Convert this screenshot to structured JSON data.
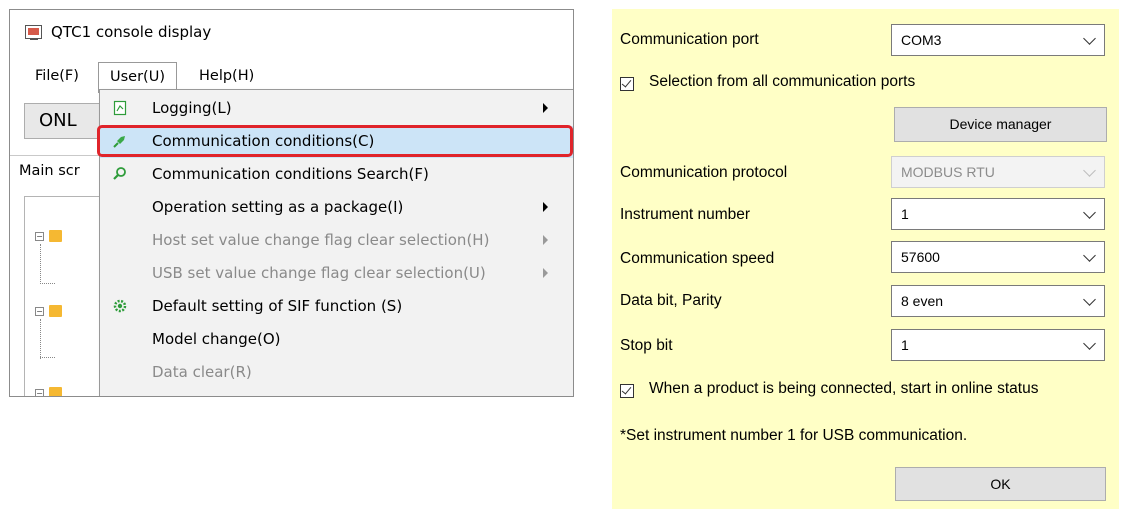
{
  "window": {
    "title": "QTC1 console display",
    "menu": {
      "file": "File(F)",
      "user": "User(U)",
      "help": "Help(H)"
    },
    "online_button": "ONL",
    "main_tab": "Main scr"
  },
  "user_menu": {
    "items": [
      {
        "label": "Logging(L)",
        "icon": "log-icon",
        "submenu": true,
        "disabled": false
      },
      {
        "label": "Communication conditions(C)",
        "icon": "plug-icon",
        "submenu": false,
        "disabled": false,
        "highlighted": true
      },
      {
        "label": "Communication conditions Search(F)",
        "icon": "search-icon",
        "submenu": false,
        "disabled": false
      },
      {
        "label": "Operation setting as a package(I)",
        "icon": "",
        "submenu": true,
        "disabled": false
      },
      {
        "label": "Host set value change flag clear selection(H)",
        "icon": "",
        "submenu": true,
        "disabled": true
      },
      {
        "label": "USB set value change flag clear selection(U)",
        "icon": "",
        "submenu": true,
        "disabled": true
      },
      {
        "label": "Default setting of SIF function (S)",
        "icon": "gear-icon",
        "submenu": false,
        "disabled": false
      },
      {
        "label": "Model change(O)",
        "icon": "",
        "submenu": false,
        "disabled": false
      },
      {
        "label": "Data clear(R)",
        "icon": "",
        "submenu": false,
        "disabled": true
      }
    ]
  },
  "dialog": {
    "port_label": "Communication port",
    "port_value": "COM3",
    "all_ports_label": "Selection from all communication ports",
    "all_ports_checked": true,
    "device_manager_button": "Device manager",
    "protocol_label": "Communication protocol",
    "protocol_value": "MODBUS RTU",
    "instrument_label": "Instrument number",
    "instrument_value": "1",
    "speed_label": "Communication speed",
    "speed_value": "57600",
    "databit_label": "Data bit, Parity",
    "databit_value": "8 even",
    "stopbit_label": "Stop bit",
    "stopbit_value": "1",
    "online_label": "When a product is being connected, start in online status",
    "online_checked": true,
    "note": "*Set instrument number 1 for USB communication.",
    "ok_button": "OK"
  },
  "colors": {
    "dialog_bg": "#ffffc6",
    "highlight_border": "#e0242b",
    "menu_highlight": "#cce4f7"
  }
}
